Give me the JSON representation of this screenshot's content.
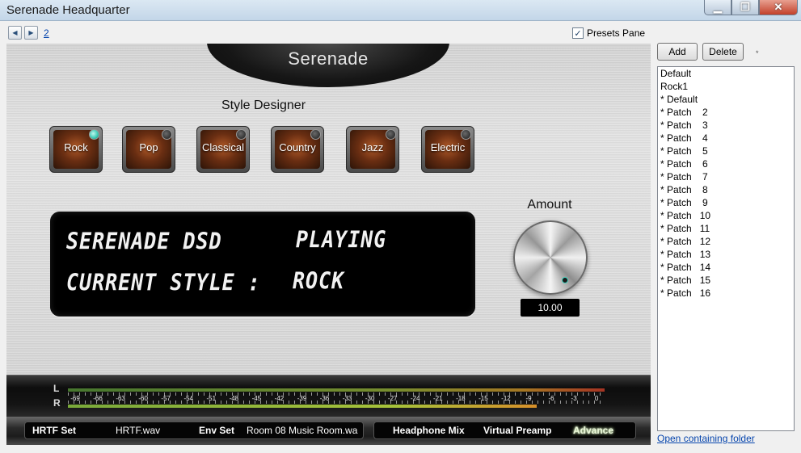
{
  "window": {
    "title": "Serenade Headquarter",
    "min": "▁",
    "max": "❐",
    "close": "✕"
  },
  "nav": {
    "back_icon": "triangle-left-icon",
    "forward_icon": "triangle-right-icon",
    "page_link": "2"
  },
  "presets_pane": {
    "label": "Presets Pane",
    "checked": true,
    "check_glyph": "✓"
  },
  "device": {
    "brand": "Serenade",
    "style_designer_title": "Style Designer",
    "styles": [
      {
        "label": "Rock",
        "active": true
      },
      {
        "label": "Pop",
        "active": false
      },
      {
        "label": "Classical",
        "active": false
      },
      {
        "label": "Country",
        "active": false
      },
      {
        "label": "Jazz",
        "active": false
      },
      {
        "label": "Electric",
        "active": false
      }
    ],
    "display": {
      "line1_left": "SERENADE DSD",
      "line1_right": "PLAYING",
      "line2_left": "CURRENT STYLE :",
      "line2_right": "ROCK"
    },
    "amount": {
      "label": "Amount",
      "value": "10.00"
    },
    "meter": {
      "left_channel": "L",
      "right_channel": "R",
      "scale": [
        "-69",
        "-66",
        "-63",
        "-60",
        "-57",
        "-54",
        "-51",
        "-48",
        "-45",
        "-42",
        "-39",
        "-36",
        "-33",
        "-30",
        "-27",
        "-24",
        "-21",
        "-18",
        "-15",
        "-12",
        "-9",
        "-6",
        "-3",
        "0"
      ]
    },
    "bottom": {
      "hrtf_label": "HRTF Set",
      "hrtf_value": "HRTF.wav",
      "env_label": "Env Set",
      "env_value": "Room 08 Music Room.wa",
      "headphone_mix": "Headphone Mix",
      "virtual_preamp": "Virtual Preamp",
      "advance": "Advance"
    }
  },
  "presets": {
    "add_label": "Add",
    "delete_label": "Delete",
    "asterisk": "*",
    "items": [
      "Default",
      "Rock1",
      "* Default",
      "* Patch    2",
      "* Patch    3",
      "* Patch    4",
      "* Patch    5",
      "* Patch    6",
      "* Patch    7",
      "* Patch    8",
      "* Patch    9",
      "* Patch   10",
      "* Patch   11",
      "* Patch   12",
      "* Patch   13",
      "* Patch   14",
      "* Patch   15",
      "* Patch   16"
    ],
    "open_folder_link": "Open containing folder"
  }
}
